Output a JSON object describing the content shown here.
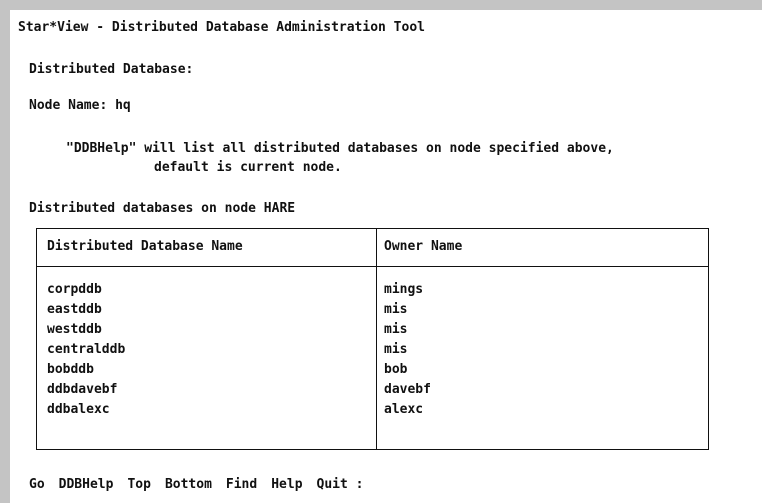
{
  "window": {
    "title": "Star*View - Distributed Database Administration Tool"
  },
  "form": {
    "ddb_label": "Distributed Database:",
    "node_label": "Node Name:",
    "node_value": "hq",
    "help_line1": "\"DDBHelp\" will list all distributed databases on node specified above,",
    "help_line2": "default is current node.",
    "list_heading": "Distributed databases on node HARE"
  },
  "table": {
    "columns": [
      "Distributed Database Name",
      "Owner Name"
    ],
    "rows": [
      {
        "name": "corpddb",
        "owner": "mings"
      },
      {
        "name": "eastddb",
        "owner": "mis"
      },
      {
        "name": "westddb",
        "owner": "mis"
      },
      {
        "name": "centralddb",
        "owner": "mis"
      },
      {
        "name": "bobddb",
        "owner": "bob"
      },
      {
        "name": "ddbdavebf",
        "owner": "davebf"
      },
      {
        "name": "ddbalexc",
        "owner": "alexc"
      }
    ]
  },
  "menu": {
    "items": [
      "Go",
      "DDBHelp",
      "Top",
      "Bottom",
      "Find",
      "Help",
      "Quit"
    ],
    "prompt": ":"
  }
}
